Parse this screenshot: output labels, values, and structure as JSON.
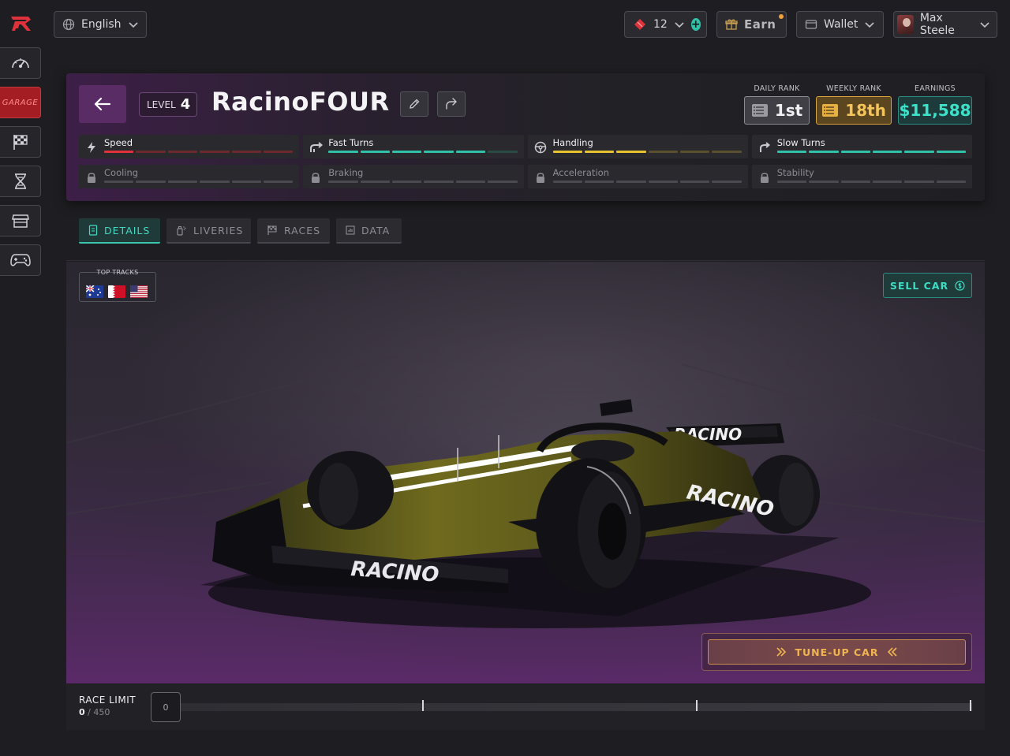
{
  "topbar": {
    "language": "English",
    "tickets_count": "12",
    "earn_label": "Earn",
    "wallet_label": "Wallet",
    "user_name": "Max Steele"
  },
  "sidenav": {
    "items": [
      {
        "name": "dashboard",
        "label": ""
      },
      {
        "name": "garage",
        "label": "GARAGE"
      },
      {
        "name": "races",
        "label": ""
      },
      {
        "name": "breeding",
        "label": ""
      },
      {
        "name": "marketplace",
        "label": ""
      },
      {
        "name": "games",
        "label": ""
      }
    ],
    "active": "garage"
  },
  "car": {
    "level_label": "LEVEL",
    "level_value": "4",
    "name": "RacinoFOUR"
  },
  "ranks": {
    "daily_label": "DAILY RANK",
    "daily_value": "1st",
    "weekly_label": "WEEKLY RANK",
    "weekly_value": "18th",
    "earnings_label": "EARNINGS",
    "earnings_value": "$11,588"
  },
  "stats": [
    {
      "name": "Speed",
      "icon": "lightning-icon",
      "locked": false,
      "filled": 1,
      "total": 6,
      "color": "#e0323a",
      "dim": "#6a2a2e"
    },
    {
      "name": "Fast Turns",
      "icon": "fast-turn-icon",
      "locked": false,
      "filled": 5,
      "total": 6,
      "color": "#2fc2a8",
      "dim": "#2a4a46"
    },
    {
      "name": "Handling",
      "icon": "steering-wheel-icon",
      "locked": false,
      "filled": 3,
      "total": 6,
      "color": "#e8c330",
      "dim": "#5a5030"
    },
    {
      "name": "Slow Turns",
      "icon": "slow-turn-icon",
      "locked": false,
      "filled": 6,
      "total": 6,
      "color": "#2fc2a8",
      "dim": "#2a4a46"
    },
    {
      "name": "Cooling",
      "icon": "lock-icon",
      "locked": true,
      "filled": 0,
      "total": 6,
      "color": "#55555b",
      "dim": "#4a4a50"
    },
    {
      "name": "Braking",
      "icon": "lock-icon",
      "locked": true,
      "filled": 0,
      "total": 6,
      "color": "#55555b",
      "dim": "#4a4a50"
    },
    {
      "name": "Acceleration",
      "icon": "lock-icon",
      "locked": true,
      "filled": 0,
      "total": 6,
      "color": "#55555b",
      "dim": "#4a4a50"
    },
    {
      "name": "Stability",
      "icon": "lock-icon",
      "locked": true,
      "filled": 0,
      "total": 6,
      "color": "#55555b",
      "dim": "#4a4a50"
    }
  ],
  "tabs": [
    {
      "label": "DETAILS",
      "active": true
    },
    {
      "label": "LIVERIES",
      "active": false
    },
    {
      "label": "RACES",
      "active": false
    },
    {
      "label": "DATA",
      "active": false
    }
  ],
  "scene": {
    "top_tracks_label": "TOP TRACKS",
    "flags": [
      "australia-flag",
      "bahrain-flag",
      "usa-flag"
    ],
    "sell_label": "SELL CAR",
    "tune_label": "TUNE-UP CAR",
    "livery_text": "RACINO"
  },
  "race_limit": {
    "label": "RACE LIMIT",
    "current": "0",
    "separator": "/",
    "max": "450",
    "knob_value": "0"
  },
  "colors": {
    "accent_teal": "#2fc2a8",
    "accent_red": "#e0323a",
    "accent_gold": "#e8c330",
    "brand_purple": "#5a2c66"
  }
}
